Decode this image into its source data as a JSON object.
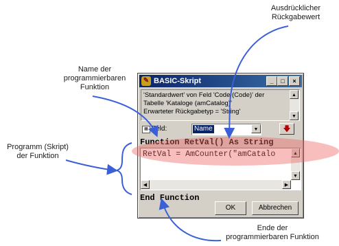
{
  "callouts": {
    "return_value": "Ausdrücklicher\nRückgabewert",
    "function_name": "Name der\nprogrammierbaren\nFunktion",
    "program": "Programm (Skript)\nder Funktion",
    "function_end": "Ende der\nprogrammierbaren Funktion"
  },
  "window": {
    "title": "BASIC-Skript",
    "controls": {
      "minimize": "_",
      "maximize": "□",
      "close": "×"
    },
    "description": [
      "'Standardwert' von Feld 'Code (Code)' der",
      "Tabelle 'Kataloge (amCatalog)'",
      "Erwarteter Rückgabetyp = 'String'"
    ],
    "field_label": "Feld:",
    "field_value": "Name",
    "code_header": "Function RetVal() As String",
    "code_line": "RetVal = AmCounter(\"amCatalo",
    "code_footer": "End Function",
    "ok_label": "OK",
    "cancel_label": "Abbrechen"
  },
  "colors": {
    "highlight": "#ee6464",
    "arrow": "#3a5fd8",
    "titlebar": "#0a246a"
  }
}
